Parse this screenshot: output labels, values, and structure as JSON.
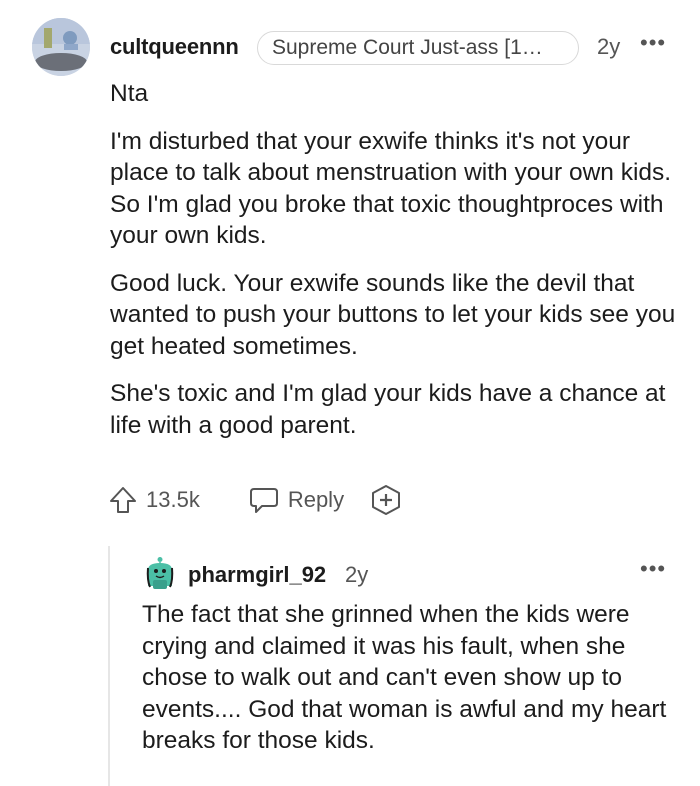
{
  "comment": {
    "username": "cultqueennn",
    "flair": "Supreme Court Just-ass [1…",
    "age": "2y",
    "more": "•••",
    "paragraphs": [
      "Nta",
      "I'm disturbed that your exwife thinks it's not your place to talk about menstruation with your own kids. So I'm glad you broke that toxic thoughtproces with your own kids.",
      "Good luck. Your exwife sounds like the devil that wanted to push your buttons to let your kids see you get heated sometimes.",
      "She's toxic and I'm glad your kids have a chance at life with a good parent."
    ],
    "votes": "13.5k",
    "reply_label": "Reply"
  },
  "reply": {
    "username": "pharmgirl_92",
    "age": "2y",
    "more": "•••",
    "text": "The fact that she grinned when the kids were crying and claimed it was his fault, when she chose to walk out and can't even show up to events.... God that woman is awful and my heart breaks for those kids."
  },
  "colors": {
    "text": "#1c1c1c",
    "meta": "#555555",
    "flair_border": "#d9d9d9",
    "thread_line": "#e6e6e6",
    "avatar2": "#4bbfa6"
  },
  "icons": [
    "upvote-icon",
    "comment-icon",
    "award-plus-icon",
    "more-icon"
  ]
}
